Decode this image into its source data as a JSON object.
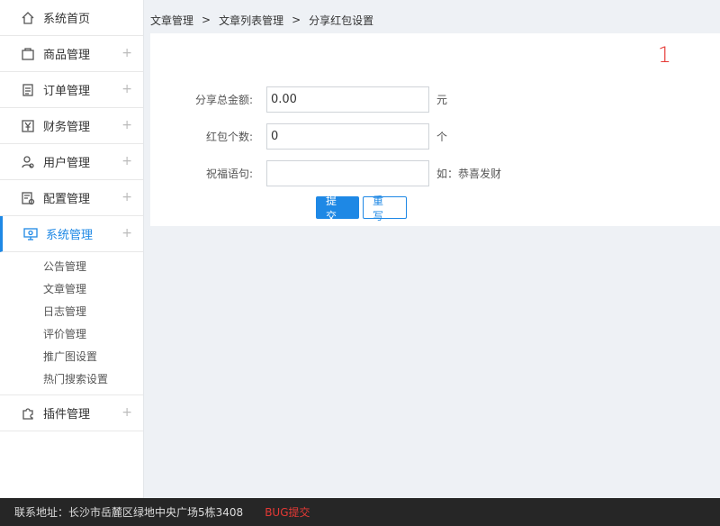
{
  "sidebar": {
    "items": [
      {
        "label": "系统首页",
        "icon": "home-icon",
        "expandable": false
      },
      {
        "label": "商品管理",
        "icon": "bag-icon",
        "expandable": true
      },
      {
        "label": "订单管理",
        "icon": "clipboard-icon",
        "expandable": true
      },
      {
        "label": "财务管理",
        "icon": "yen-icon",
        "expandable": true
      },
      {
        "label": "用户管理",
        "icon": "user-icon",
        "expandable": true
      },
      {
        "label": "配置管理",
        "icon": "config-icon",
        "expandable": true
      },
      {
        "label": "系统管理",
        "icon": "monitor-icon",
        "expandable": true,
        "active": true
      },
      {
        "label": "插件管理",
        "icon": "puzzle-icon",
        "expandable": true
      }
    ],
    "plus_symbol": "+",
    "submenu": [
      "公告管理",
      "文章管理",
      "日志管理",
      "评价管理",
      "推广图设置",
      "热门搜索设置"
    ]
  },
  "breadcrumb": {
    "items": [
      "文章管理",
      "文章列表管理",
      "分享红包设置"
    ],
    "separator": ">"
  },
  "marker": "1",
  "form": {
    "total_amount": {
      "label": "分享总金额:",
      "value": "0.00",
      "suffix": "元"
    },
    "count": {
      "label": "红包个数:",
      "value": "0",
      "suffix": "个"
    },
    "greeting": {
      "label": "祝福语句:",
      "value": "",
      "suffix": "如：恭喜发财"
    },
    "submit_label": "提交",
    "reset_label": "重写"
  },
  "footer": {
    "address": "联系地址：长沙市岳麓区绿地中央广场5栋3408",
    "bug_link": "BUG提交"
  },
  "colors": {
    "accent": "#1e88e5",
    "marker": "#e53935",
    "footer_bg": "#262626",
    "page_bg": "#eef1f5"
  }
}
